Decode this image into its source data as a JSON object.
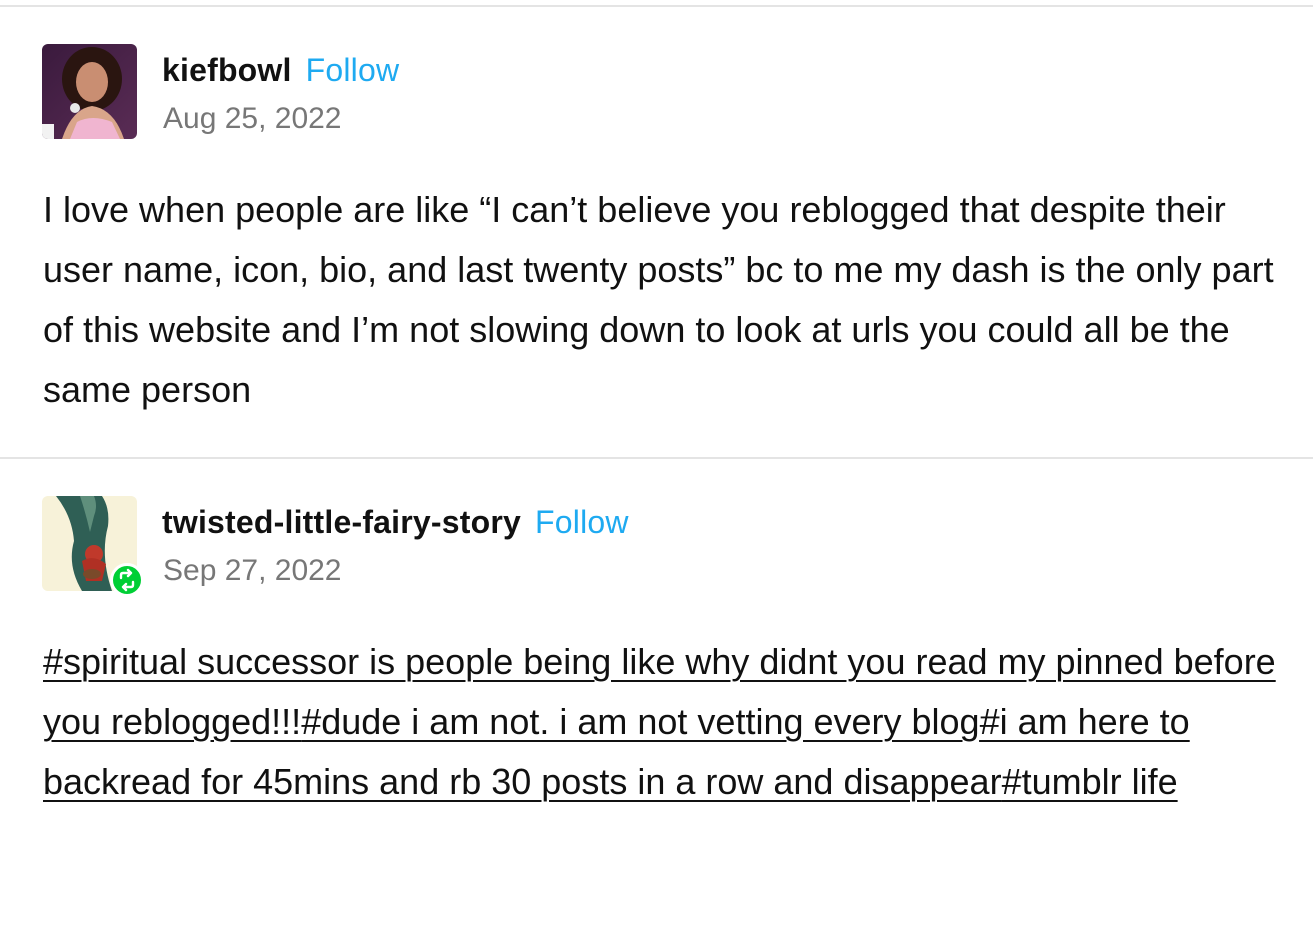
{
  "posts": [
    {
      "username": "kiefbowl",
      "follow_label": "Follow",
      "date": "Aug 25, 2022",
      "body": "I love when people are like “I can’t believe you reblogged that despite their user name, icon, bio, and last twenty posts” bc to me my dash is the only part of this website and I’m not slowing down to look at urls you could all be the same person"
    },
    {
      "username": "twisted-little-fairy-story",
      "follow_label": "Follow",
      "date": "Sep 27, 2022",
      "tags": [
        "#spiritual successor is people being like why didnt you read my pinned before you reblogged!!!",
        "#dude i am not. i am not vetting every blog",
        "#i am here to backread for 45mins and rb 30 posts in a row and disappear",
        "#tumblr life"
      ]
    }
  ],
  "colors": {
    "follow": "#1eaaf1",
    "divider": "#e4e4e4",
    "date": "#777777",
    "reblog_badge": "#00cf35"
  },
  "icons": {
    "reblog": "reblog-icon"
  }
}
